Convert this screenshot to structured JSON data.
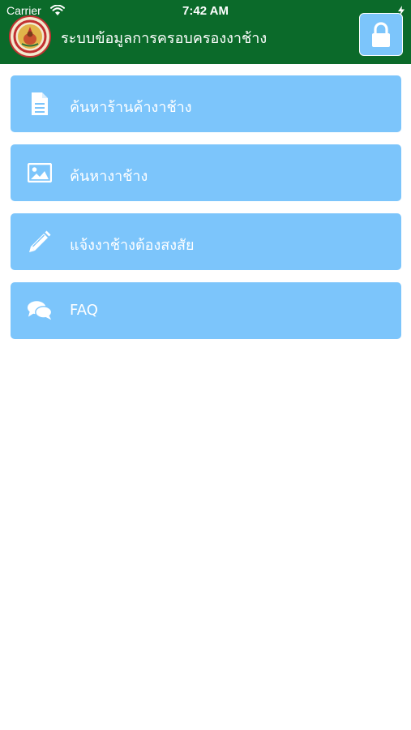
{
  "status_bar": {
    "carrier": "Carrier",
    "time": "7:42 AM"
  },
  "header": {
    "title": "ระบบข้อมูลการครอบครองงาช้าง",
    "background_color": "#0b6a2a",
    "lock_icon": "lock-icon"
  },
  "menu": {
    "button_color": "#7cc5fb",
    "items": [
      {
        "label": "ค้นหาร้านค้างาช้าง",
        "icon": "document-icon"
      },
      {
        "label": "ค้นหางาช้าง",
        "icon": "image-icon"
      },
      {
        "label": "แจ้งงาช้างต้องสงสัย",
        "icon": "pencil-icon"
      },
      {
        "label": "FAQ",
        "icon": "chat-bubbles-icon"
      }
    ]
  }
}
